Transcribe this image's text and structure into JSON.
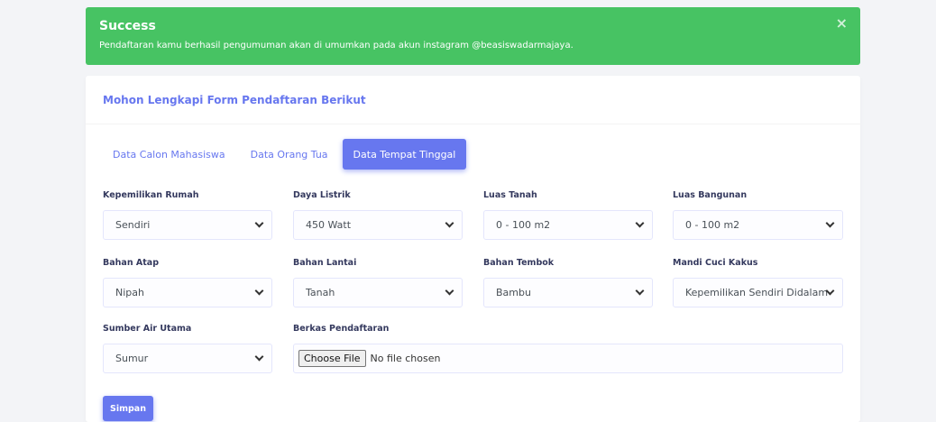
{
  "alert": {
    "title": "Success",
    "message": "Pendaftaran kamu berhasil pengumuman akan di umumkan pada akun instagram @beasiswadarmajaya.",
    "close": "×"
  },
  "card": {
    "title": "Mohon Lengkapi Form Pendaftaran Berikut"
  },
  "tabs": [
    {
      "label": "Data Calon Mahasiswa",
      "active": false
    },
    {
      "label": "Data Orang Tua",
      "active": false
    },
    {
      "label": "Data Tempat Tinggal",
      "active": true
    }
  ],
  "fields": {
    "kepemilikan_rumah": {
      "label": "Kepemilikan Rumah",
      "value": "Sendiri"
    },
    "daya_listrik": {
      "label": "Daya Listrik",
      "value": "450 Watt"
    },
    "luas_tanah": {
      "label": "Luas Tanah",
      "value": "0 - 100 m2"
    },
    "luas_bangunan": {
      "label": "Luas Bangunan",
      "value": "0 - 100 m2"
    },
    "bahan_atap": {
      "label": "Bahan Atap",
      "value": "Nipah"
    },
    "bahan_lantai": {
      "label": "Bahan Lantai",
      "value": "Tanah"
    },
    "bahan_tembok": {
      "label": "Bahan Tembok",
      "value": "Bambu"
    },
    "mck": {
      "label": "Mandi Cuci Kakus",
      "value": "Kepemilikan Sendiri Didalam"
    },
    "sumber_air": {
      "label": "Sumber Air Utama",
      "value": "Sumur"
    },
    "berkas": {
      "label": "Berkas Pendaftaran",
      "button": "Choose File",
      "status": "No file chosen"
    }
  },
  "actions": {
    "save_label": "Simpan"
  },
  "colors": {
    "primary": "#6777ef",
    "success": "#47c363",
    "background": "#f3f4f7"
  }
}
